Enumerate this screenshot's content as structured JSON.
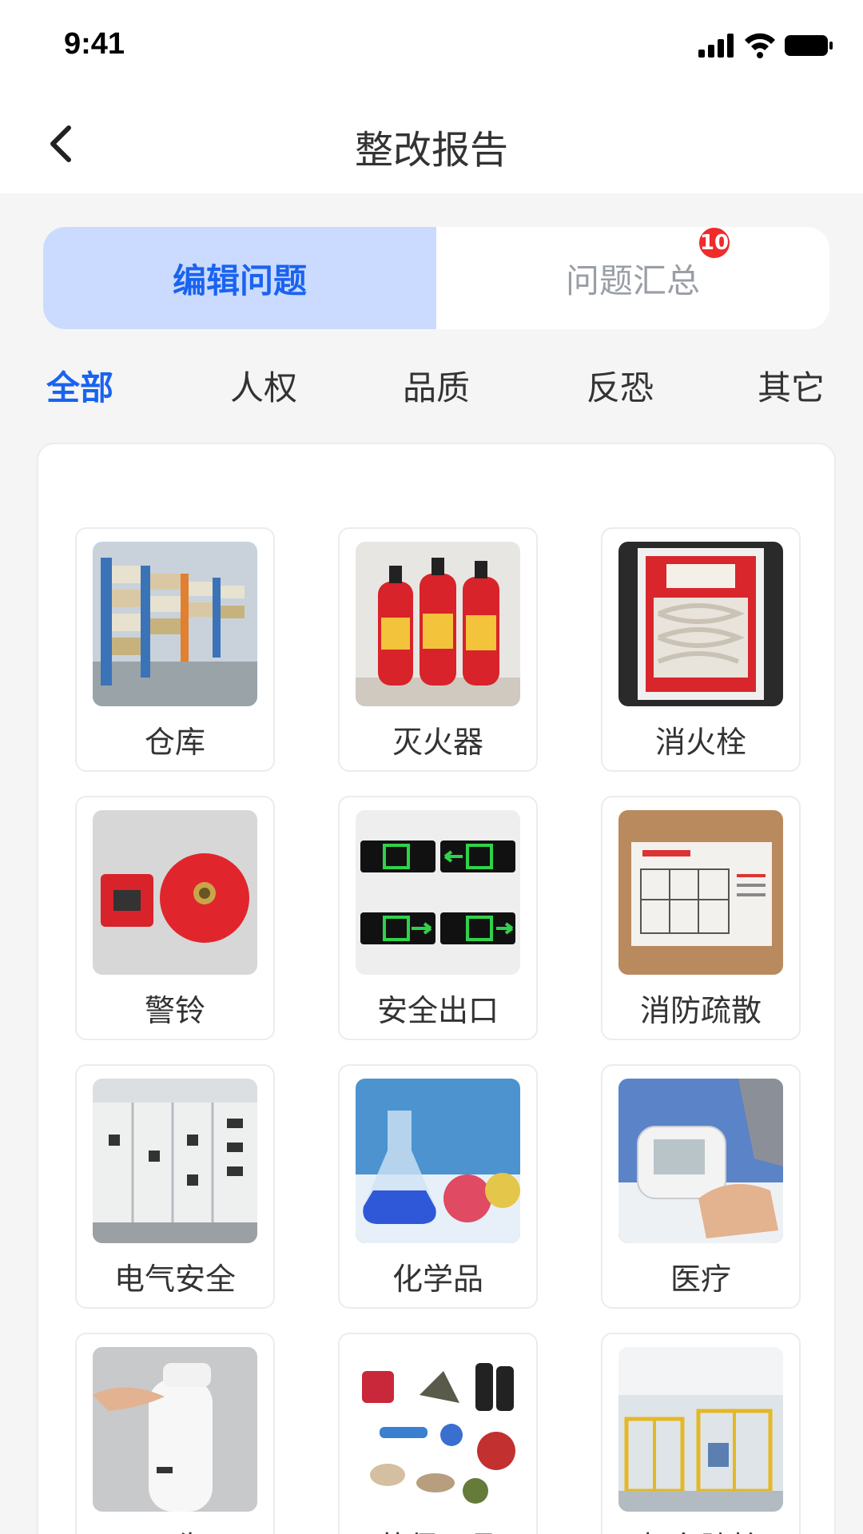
{
  "status": {
    "time": "9:41"
  },
  "nav": {
    "title": "整改报告"
  },
  "segment": {
    "tabs": [
      {
        "label": "编辑问题"
      },
      {
        "label": "问题汇总",
        "badge": "10"
      }
    ]
  },
  "categories": [
    "全部",
    "人权",
    "品质",
    "反恐",
    "其它"
  ],
  "grid": {
    "items": [
      {
        "label": "仓库",
        "icon": "warehouse-image"
      },
      {
        "label": "灭火器",
        "icon": "fire-extinguisher-image"
      },
      {
        "label": "消火栓",
        "icon": "fire-hydrant-box-image"
      },
      {
        "label": "警铃",
        "icon": "alarm-bell-image"
      },
      {
        "label": "安全出口",
        "icon": "exit-sign-image"
      },
      {
        "label": "消防疏散",
        "icon": "evacuation-map-image"
      },
      {
        "label": "电气安全",
        "icon": "electrical-cabinet-image"
      },
      {
        "label": "化学品",
        "icon": "chemical-flask-image"
      },
      {
        "label": "医疗",
        "icon": "blood-pressure-monitor-image"
      },
      {
        "label": "卫生",
        "icon": "soap-dispenser-image"
      },
      {
        "label": "劳保用品",
        "icon": "protective-gear-image"
      },
      {
        "label": "机台防护",
        "icon": "machine-guard-image"
      }
    ]
  },
  "colors": {
    "accent": "#1a63f0",
    "segment_active_bg": "#cadbff",
    "badge": "#ef2b2b",
    "page_bg": "#f5f5f5"
  }
}
